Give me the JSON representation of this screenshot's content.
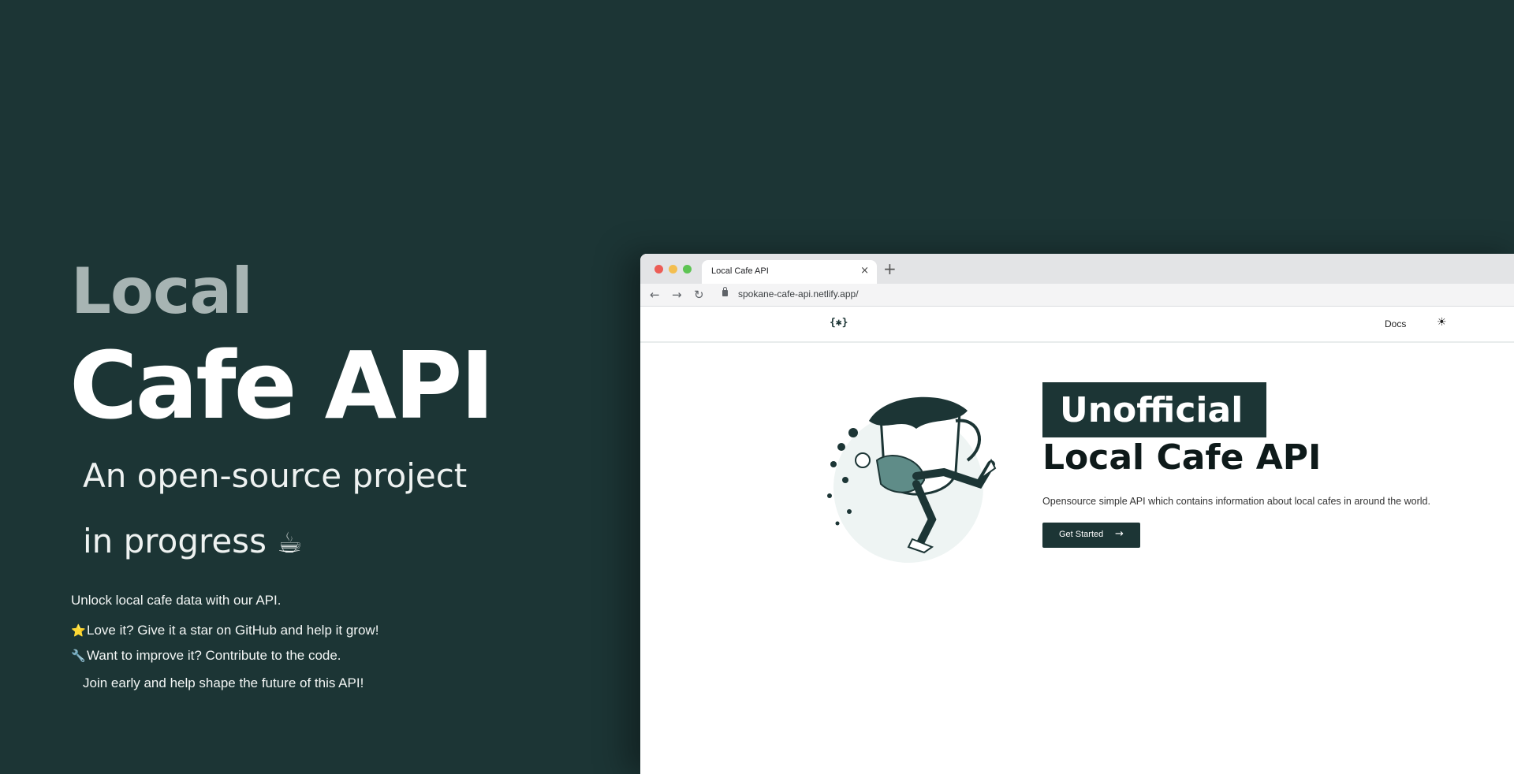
{
  "hero": {
    "line1": "Local",
    "line2": "Cafe API",
    "subtitle_line1": "An open-source project",
    "subtitle_line2": "in progress",
    "subtitle_emoji": "☕",
    "bullets": [
      {
        "icon": "",
        "text": "Unlock local cafe data with our API."
      },
      {
        "icon": "⭐",
        "text": "Love it? Give it a star on GitHub and help it grow!"
      },
      {
        "icon": "🔧",
        "text": "Want to improve it? Contribute to the code."
      },
      {
        "icon": "",
        "text": "Join early and help shape the future of this API!"
      }
    ]
  },
  "browser": {
    "tab_title": "Local Cafe API",
    "tab_close": "×",
    "new_tab": "+",
    "url": "spokane-cafe-api.netlify.app/",
    "nav": {
      "back": "←",
      "forward": "→",
      "reload": "↻"
    }
  },
  "site": {
    "logo": "{✱}",
    "docs": "Docs",
    "theme_icon": "☀",
    "badge": "Unofficial",
    "title": "Local Cafe API",
    "description": "Opensource simple API which contains information about local cafes in around the world.",
    "cta": "Get Started",
    "cta_arrow": "→"
  },
  "colors": {
    "background": "#1c3535",
    "accent": "#1c3535",
    "muted_heading": "#a7b4b3"
  }
}
